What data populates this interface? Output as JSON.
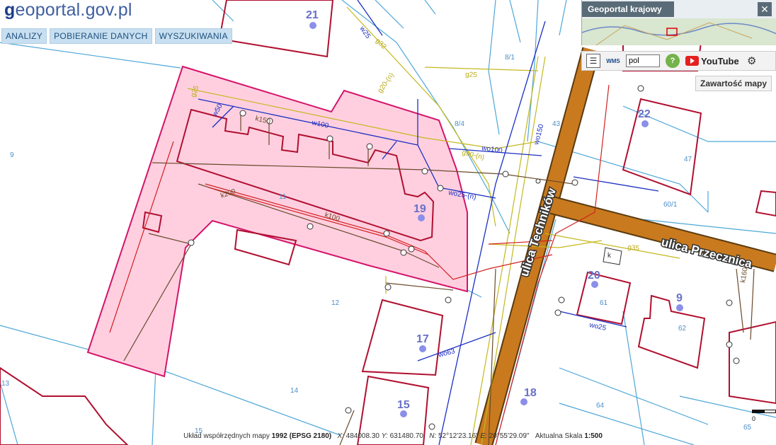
{
  "header": {
    "logo_prefix": "g",
    "logo_text": "eoportal.gov.pl",
    "nav": [
      "ANALIZY",
      "POBIERANIE DANYCH",
      "WYSZUKIWANIA"
    ]
  },
  "overview": {
    "title": "Geoportal krajowy",
    "close_icon": "close-icon"
  },
  "toolbar": {
    "list_icon": "list-icon",
    "wms_label": "WMS",
    "language": "pol",
    "help_label": "?",
    "youtube_label": "YouTube",
    "settings_icon": "settings-icon"
  },
  "map_contents_button": "Zawartość mapy",
  "map": {
    "streets": [
      "ulica Techników",
      "ulica Przecznica"
    ],
    "building_numbers": [
      "21",
      "19",
      "22",
      "20",
      "9",
      "17",
      "15",
      "18"
    ],
    "parcels": [
      "9",
      "8/1",
      "8/4",
      "47",
      "60/1",
      "11",
      "12",
      "13",
      "14",
      "15",
      "43",
      "61",
      "62",
      "64",
      "65"
    ],
    "utility_labels": [
      "w25",
      "w50",
      "w100",
      "wo100",
      "wo150",
      "wo25-(n)",
      "wo25",
      "wo63",
      "k150",
      "k200",
      "k100",
      "k160",
      "g25",
      "g32",
      "g20-(n)",
      "g25",
      "g90-(n)",
      "g35"
    ],
    "colors": {
      "highlight_fill": "#ffcfe0",
      "highlight_stroke": "#d4146a",
      "building_outline": "#b01030",
      "road": "#c97a1e",
      "water": "#1c2fc2",
      "sewer": "#6a4a2a",
      "gas": "#c4b81e",
      "parcel_line": "#4da7d8"
    }
  },
  "status": {
    "crs_label": "Układ współrzędnych mapy",
    "crs_value": "1992 (EPSG 2180)",
    "x_label": "X:",
    "x_value": "484008.30",
    "y_label": "Y:",
    "y_value": "631480.70",
    "n_label": "N:",
    "n_value": "52°12'23.16\"",
    "e_label": "E:",
    "e_value": "20°55'29.09\"",
    "scale_label": "Aktualna Skala",
    "scale_value": "1:500"
  },
  "scalebar_label": "0"
}
